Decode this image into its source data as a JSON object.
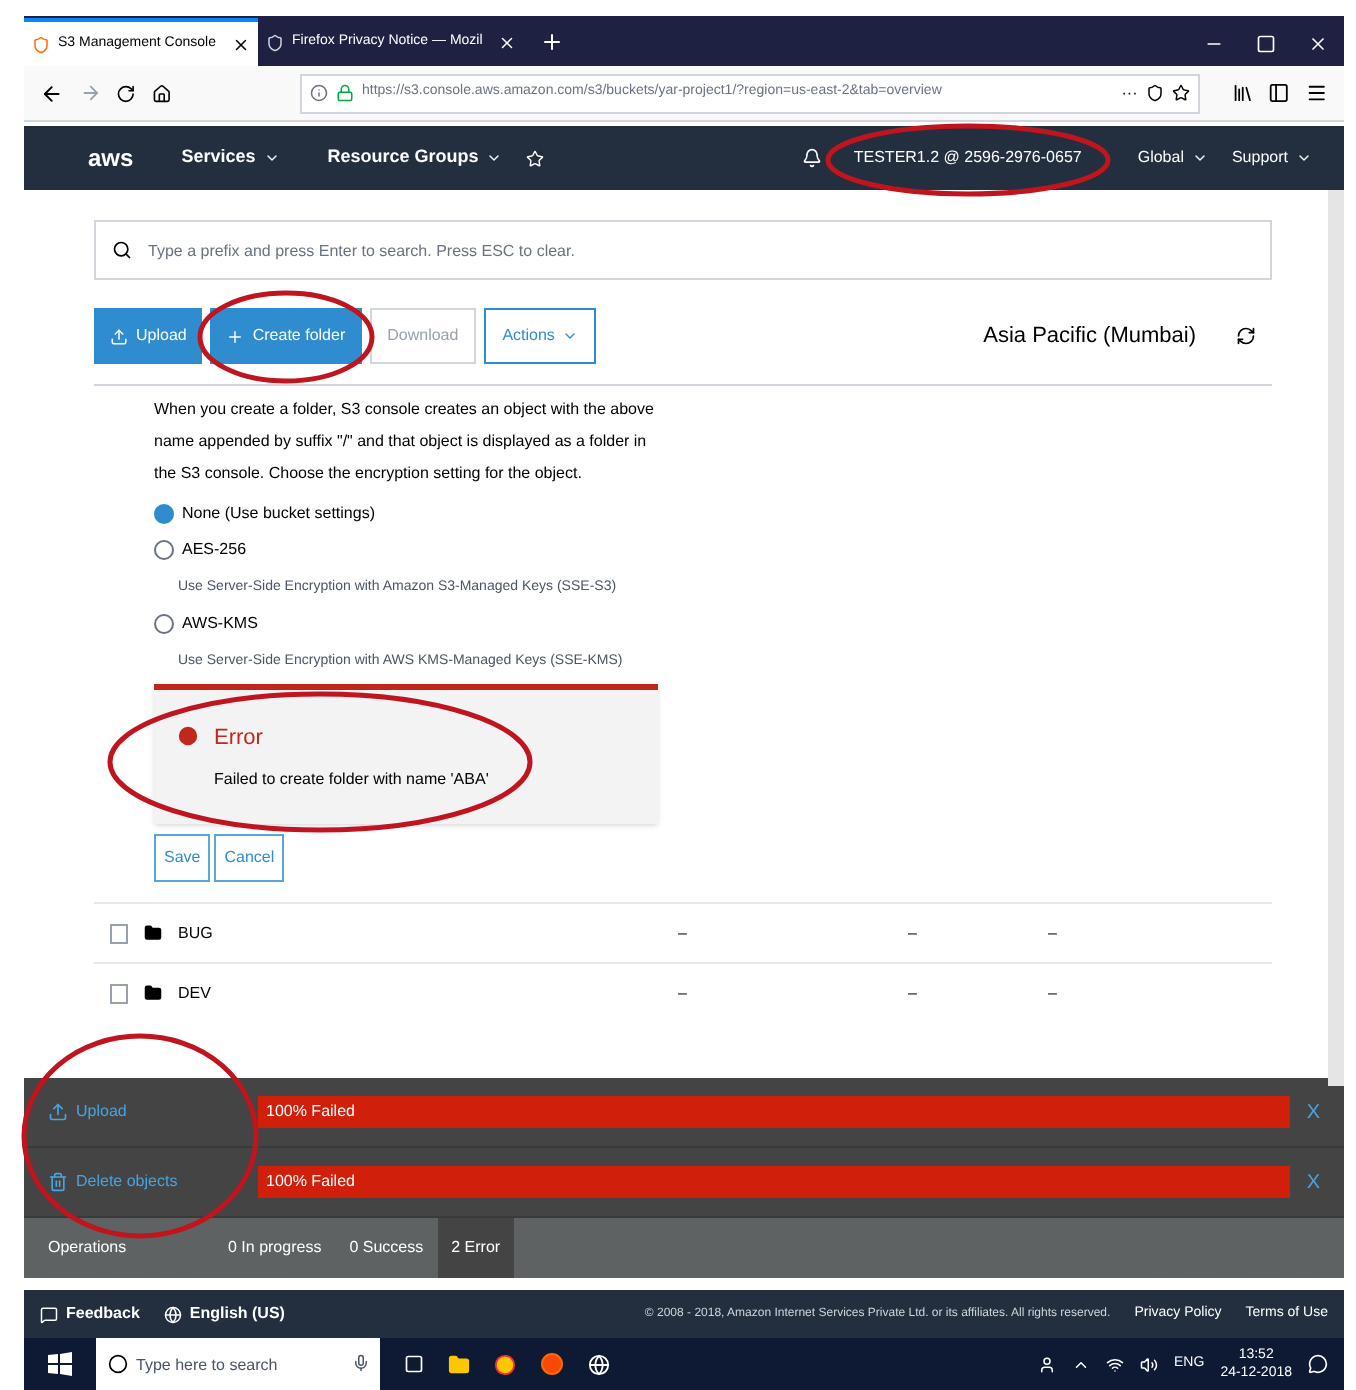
{
  "browser": {
    "tabs": [
      {
        "label": "S3 Management Console",
        "selected": true
      },
      {
        "label": "Firefox Privacy Notice — Mozil",
        "selected": false
      }
    ],
    "url": "https://s3.console.aws.amazon.com/s3/buckets/yar-project1/?region=us-east-2&tab=overview",
    "url_more": "···"
  },
  "aws_nav": {
    "logo": "aws",
    "items": [
      "Services",
      "Resource Groups"
    ],
    "account": "TESTER1.2 @ 2596-2976-0657",
    "region": "Global",
    "support": "Support"
  },
  "search": {
    "placeholder": "Type a prefix and press Enter to search. Press ESC to clear."
  },
  "toolbar": {
    "buttons": [
      {
        "label": "Upload",
        "kind": "primary",
        "disabled": false
      },
      {
        "label": "Create folder",
        "kind": "primary",
        "disabled": false
      },
      {
        "label": "Download",
        "kind": "plain",
        "disabled": true
      },
      {
        "label": "Actions",
        "kind": "dropdown",
        "disabled": false
      }
    ],
    "region": "Asia Pacific (Mumbai)"
  },
  "create_folder": {
    "description": "When you create a folder, S3 console creates an object with the above name appended by suffix \"/\" and that object is displayed as a folder in the S3 console. Choose the encryption setting for the object.",
    "options": [
      {
        "label": "None (Use bucket settings)",
        "selected": true
      },
      {
        "label": "AES-256",
        "selected": false,
        "note": "Use Server-Side Encryption with Amazon S3-Managed Keys (SSE-S3)"
      },
      {
        "label": "AWS-KMS",
        "selected": false,
        "note": "Use Server-Side Encryption with AWS KMS-Managed Keys (SSE-KMS)"
      }
    ],
    "error": {
      "title": "Error",
      "message": "Failed to create folder with name 'ABA'"
    },
    "buttons": [
      "Save",
      "Cancel"
    ]
  },
  "rows": [
    {
      "name": "BUG",
      "checked": false,
      "column_2": "–",
      "column_3": "–",
      "column_4": "–"
    },
    {
      "name": "DEV",
      "checked": false,
      "column_2": "–",
      "column_3": "–",
      "column_4": "–"
    }
  ],
  "operations": {
    "items": [
      {
        "label": "Upload",
        "kind": "upload",
        "status": "100% Failed",
        "level": 1,
        "close": "X"
      },
      {
        "label": "Delete objects",
        "kind": "delete",
        "status": "100% Failed",
        "level": 1,
        "close": "X"
      }
    ],
    "tabs": [
      {
        "label": "Operations",
        "selected": false
      },
      {
        "label": "0 In progress",
        "selected": false
      },
      {
        "label": "0 Success",
        "selected": false
      },
      {
        "label": "2 Error",
        "selected": true
      }
    ]
  },
  "footer": {
    "feedback": "Feedback",
    "language": "English (US)",
    "copyright": "© 2008 - 2018, Amazon Internet Services Private Ltd. or its affiliates. All rights reserved.",
    "links": [
      "Privacy Policy",
      "Terms of Use"
    ]
  },
  "taskbar": {
    "search_placeholder": "Type here to search",
    "lang": "ENG",
    "time": "13:52",
    "date": "24-12-2018"
  }
}
